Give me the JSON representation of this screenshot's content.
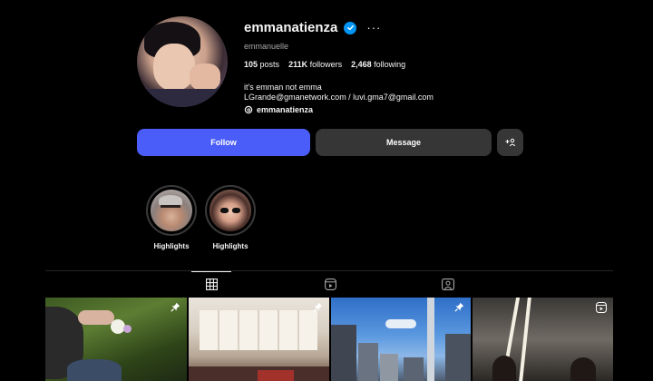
{
  "profile": {
    "username": "emmanatienza",
    "full_name": "emmanuelle",
    "stats": {
      "posts_count": "105",
      "posts_label": "posts",
      "followers_count": "211K",
      "followers_label": "followers",
      "following_count": "2,468",
      "following_label": "following"
    },
    "bio": {
      "line1": "it's emman not emma",
      "line2": "LGrande@gmanetwork.com / luvi.gma7@gmail.com"
    },
    "threads_handle": "emmanatienza"
  },
  "actions": {
    "follow_label": "Follow",
    "message_label": "Message"
  },
  "highlights": [
    {
      "label": "Highlights"
    },
    {
      "label": "Highlights"
    }
  ],
  "tabs": [
    "grid-icon",
    "reels-icon",
    "tagged-icon"
  ],
  "colors": {
    "background": "#000000",
    "follow_button": "#4a5df9",
    "secondary_button": "#363636",
    "verified": "#0095f6",
    "muted_text": "#a8a8a8"
  }
}
